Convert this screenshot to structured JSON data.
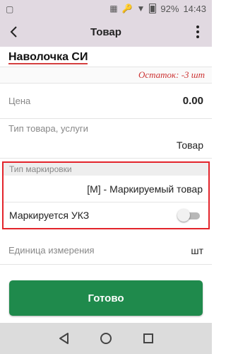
{
  "status_bar": {
    "battery": "92%",
    "time": "14:43"
  },
  "app_bar": {
    "title": "Товар"
  },
  "product": {
    "name": "Наволочка СИ",
    "stock": "Остаток: -3 шт"
  },
  "fields": {
    "price_label": "Цена",
    "price_value": "0.00",
    "type_label": "Тип товара, услуги",
    "type_value": "Товар",
    "marking_label": "Тип маркировки",
    "marking_value": "[М] - Маркируемый товар",
    "ukz_label": "Маркируется УКЗ",
    "ukz_enabled": false,
    "unit_label": "Единица измерения",
    "unit_value": "шт"
  },
  "actions": {
    "done_label": "Готово"
  },
  "colors": {
    "accent_green": "#1f8a4c",
    "highlight_red": "#e3242b",
    "app_bar_bg": "#e1d9e1"
  }
}
